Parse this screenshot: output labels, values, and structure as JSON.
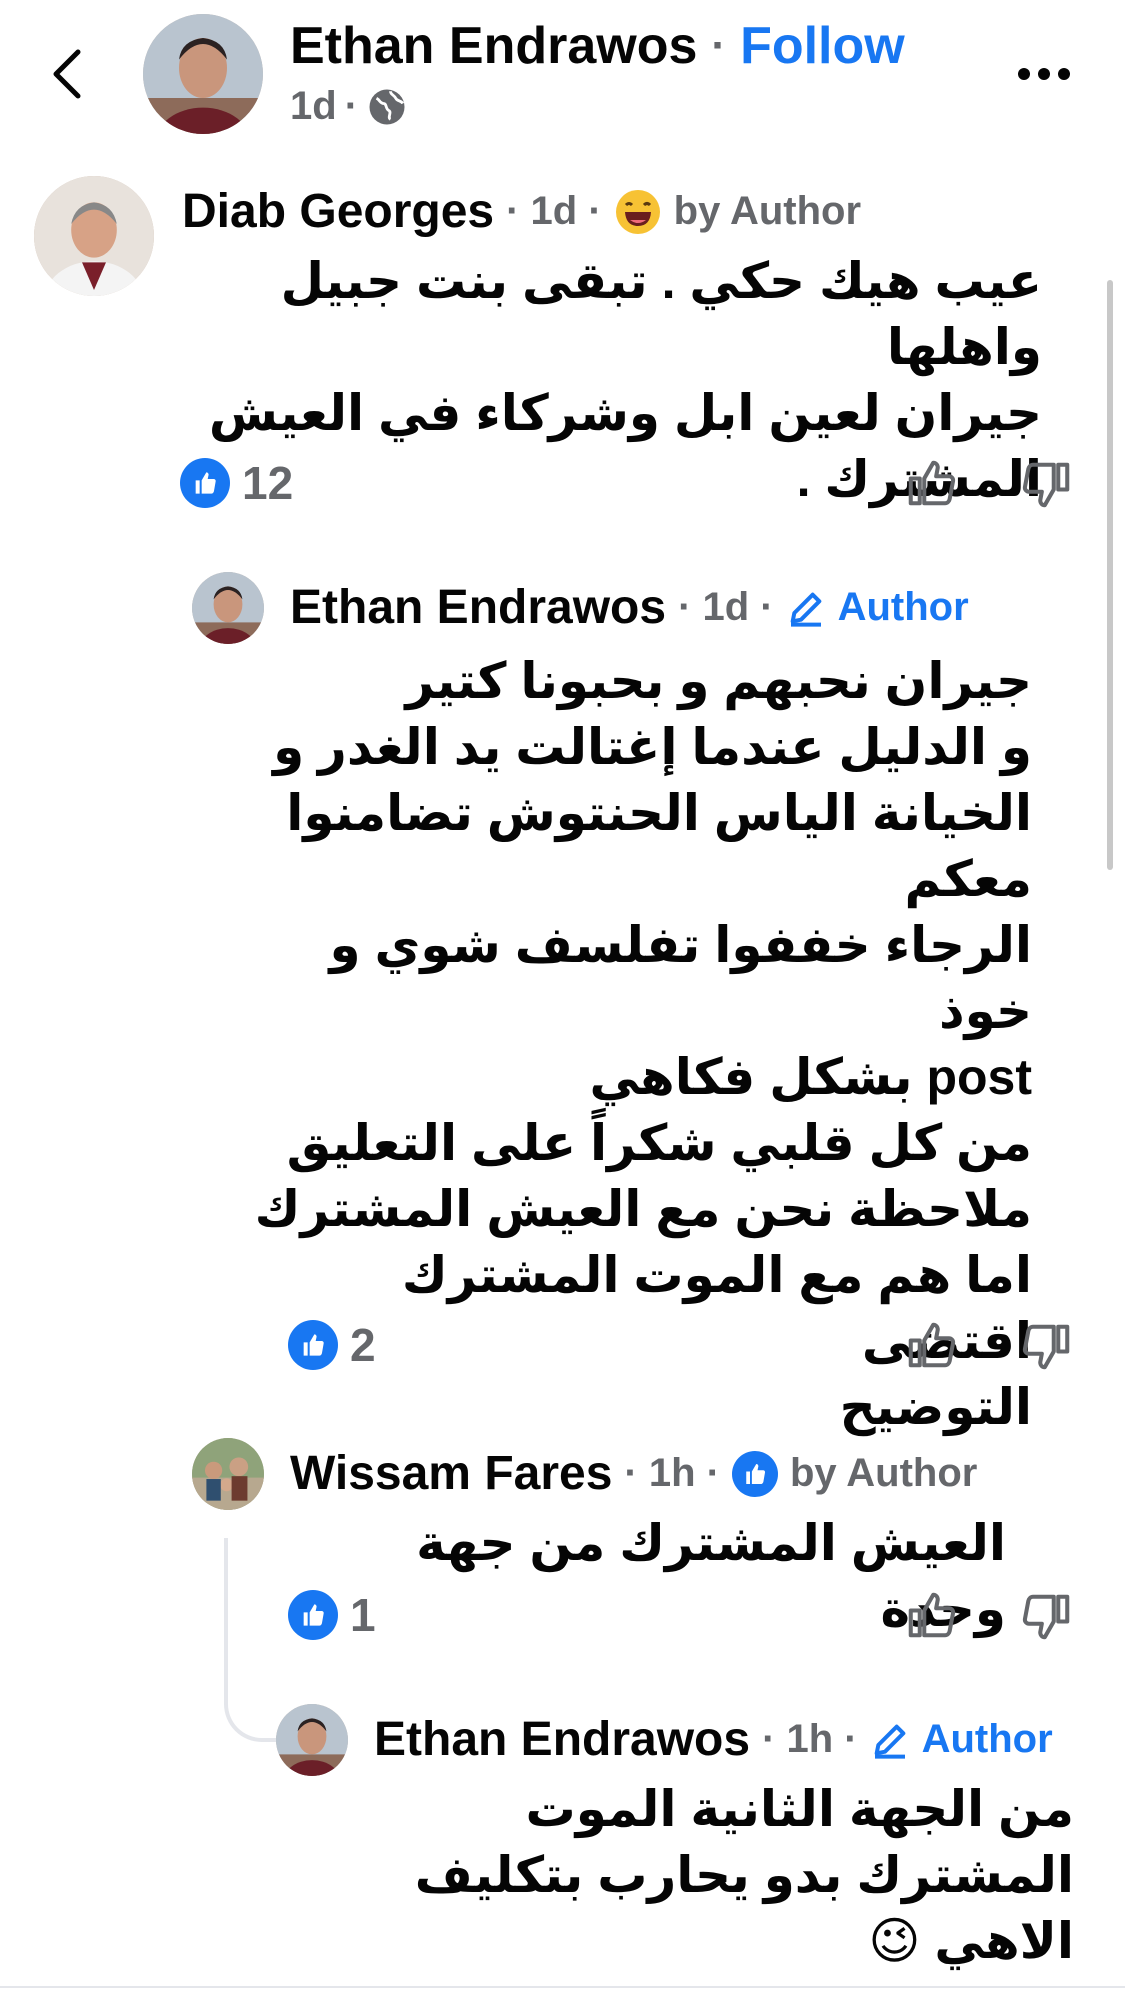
{
  "header": {
    "author_name": "Ethan Endrawos",
    "separator": "·",
    "follow_label": "Follow",
    "time": "1d",
    "dot": "·",
    "privacy_icon": "globe-icon",
    "more_icon": "more-icon",
    "back_icon": "back-chevron-icon"
  },
  "colors": {
    "accent": "#1877f2",
    "meta": "#65676b",
    "text": "#050505"
  },
  "comments": [
    {
      "name": "Diab Georges",
      "meta_time": "· 1d ·",
      "badge_text": "by Author",
      "badge_icon": "laughing-emoji-icon",
      "text": "عيب هيك حكي . تبقى بنت جبيل واهلها\nجيران لعين ابل وشركاء في العيش\nالمشترك  .",
      "likes": "12"
    },
    {
      "name": "Ethan Endrawos",
      "meta_time": "· 1d ·",
      "badge_text": "Author",
      "badge_icon": "pencil-icon",
      "text": "جيران نحبهم و بحبونا كتير\nو الدليل عندما إغتالت يد الغدر و\nالخيانة الياس الحنتوش تضامنوا\nمعكم\nالرجاء خففوا تفلسف شوي و خوذ\npost بشكل فكاهي\nمن كل قلبي شكراً على التعليق\nملاحظة نحن مع العيش المشترك\nاما هم مع الموت المشترك اقتضى\nالتوضيح",
      "likes": "2"
    },
    {
      "name": "Wissam Fares",
      "meta_time": "· 1h ·",
      "badge_text": "by Author",
      "badge_icon": "like-badge-icon",
      "text": "العيش المشترك من جهة وحدة",
      "likes": "1"
    },
    {
      "name": "Ethan Endrawos",
      "meta_time": "· 1h ·",
      "badge_text": "Author",
      "badge_icon": "pencil-icon",
      "text": "من الجهة الثانية الموت\nالمشترك بدو يحارب بتكليف\nالاهي 😉"
    }
  ]
}
